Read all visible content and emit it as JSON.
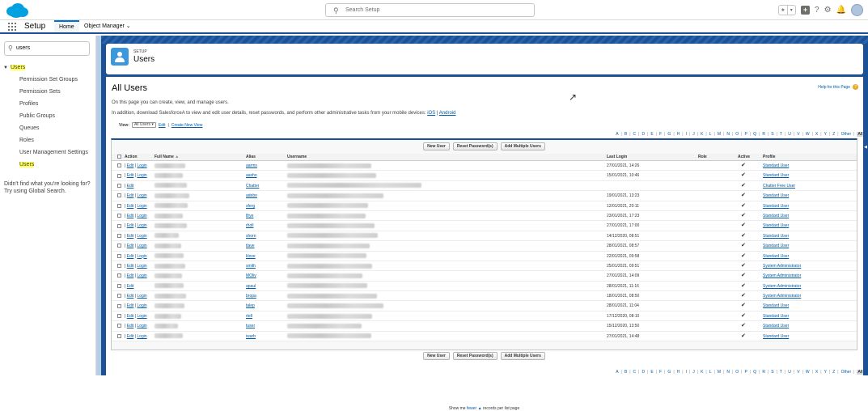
{
  "topbar": {
    "search_placeholder": "Search Setup"
  },
  "nav": {
    "app_name": "Setup",
    "tabs": [
      "Home",
      "Object Manager"
    ]
  },
  "sidebar": {
    "quickfind_value": "users",
    "parent": "Users",
    "items": [
      "Permission Set Groups",
      "Permission Sets",
      "Profiles",
      "Public Groups",
      "Queues",
      "Roles",
      "User Management Settings",
      "Users"
    ],
    "note": "Didn't find what you're looking for? Try using Global Search."
  },
  "header": {
    "setup": "SETUP",
    "title": "Users"
  },
  "page": {
    "title": "All Users",
    "help": "Help for this Page",
    "desc1": "On this page you can create, view, and manage users.",
    "desc2": "In addition, download SalesforceA to view and edit user details, reset passwords, and perform other administrative tasks from your mobile devices:",
    "ios": "iOS",
    "sep": " | ",
    "android": "Android",
    "view_label": "View:",
    "view_value": "All Users",
    "edit": "Edit",
    "create_view": "Create New View",
    "alpha": [
      "A",
      "B",
      "C",
      "D",
      "E",
      "F",
      "G",
      "H",
      "I",
      "J",
      "K",
      "L",
      "M",
      "N",
      "O",
      "P",
      "Q",
      "R",
      "S",
      "T",
      "U",
      "V",
      "W",
      "X",
      "Y",
      "Z",
      "Other",
      "All"
    ],
    "buttons": [
      "New User",
      "Reset Password(s)",
      "Add Multiple Users"
    ],
    "footer_pre": "Show me",
    "footer_link": "fewer",
    "footer_post": "records per list page"
  },
  "table": {
    "headers": {
      "action": "Action",
      "full_name": "Full Name",
      "sort": "▲",
      "alias": "Alias",
      "username": "Username",
      "last_login": "Last Login",
      "role": "Role",
      "active": "Active",
      "profile": "Profile"
    },
    "rows": [
      {
        "login": true,
        "alias": "aarms",
        "last_login": "27/01/2021, 14:26",
        "profile": "Standard User",
        "fn": 38,
        "un": 104
      },
      {
        "login": true,
        "alias": "aasho",
        "last_login": "15/01/2021, 10:46",
        "profile": "Standard User",
        "fn": 35,
        "un": 110
      },
      {
        "login": false,
        "alias": "Chatter",
        "last_login": "",
        "profile": "Chatter Free User",
        "fn": 40,
        "un": 166
      },
      {
        "login": true,
        "alias": "adebo",
        "last_login": "19/01/2021, 13:23",
        "profile": "Standard User",
        "fn": 43,
        "un": 119
      },
      {
        "login": true,
        "alias": "sferg",
        "last_login": "12/01/2021, 20:11",
        "profile": "Standard User",
        "fn": 41,
        "un": 100
      },
      {
        "login": true,
        "alias": "lfrye",
        "last_login": "23/01/2021, 17:23",
        "profile": "Standard User",
        "fn": 35,
        "un": 97
      },
      {
        "login": true,
        "alias": "rholl",
        "last_login": "27/01/2021, 17:00",
        "profile": "Standard User",
        "fn": 40,
        "un": 108
      },
      {
        "login": true,
        "alias": "shorn",
        "last_login": "14/12/2020, 08:51",
        "profile": "Standard User",
        "fn": 30,
        "un": 112
      },
      {
        "login": true,
        "alias": "tlave",
        "last_login": "28/01/2021, 08:57",
        "profile": "Standard User",
        "fn": 33,
        "un": 102
      },
      {
        "login": true,
        "alias": "klove",
        "last_login": "22/01/2021, 09:58",
        "profile": "Standard User",
        "fn": 36,
        "un": 98
      },
      {
        "login": true,
        "alias": "smith",
        "last_login": "25/01/2021, 09:51",
        "profile": "System Administrator",
        "fn": 38,
        "un": 105
      },
      {
        "login": true,
        "alias": "MOliv",
        "last_login": "27/01/2021, 14:09",
        "profile": "System Administrator",
        "fn": 34,
        "un": 93
      },
      {
        "login": false,
        "alias": "apaul",
        "last_login": "28/01/2021, 11:16",
        "profile": "System Administrator",
        "fn": 36,
        "un": 99
      },
      {
        "login": true,
        "alias": "bropa",
        "last_login": "18/01/2021, 08:50",
        "profile": "System Administrator",
        "fn": 39,
        "un": 111
      },
      {
        "login": true,
        "alias": "talep",
        "last_login": "28/01/2021, 11:04",
        "profile": "Standard User",
        "fn": 37,
        "un": 119
      },
      {
        "login": true,
        "alias": "rtell",
        "last_login": "17/12/2020, 08:10",
        "profile": "Standard User",
        "fn": 33,
        "un": 105
      },
      {
        "login": true,
        "alias": "tuser",
        "last_login": "15/12/2020, 13:50",
        "profile": "Standard User",
        "fn": 29,
        "un": 92
      },
      {
        "login": true,
        "alias": "iwarb",
        "last_login": "27/01/2021, 14:48",
        "profile": "Standard User",
        "fn": 35,
        "un": 104
      }
    ],
    "edit_label": "Edit",
    "login_label": "Login",
    "active_mark": "✔"
  },
  "colors": {
    "brand": "#1b5297",
    "link": "#015ba7",
    "highlight": "#ffff5a"
  },
  "icons": [
    "salesforce-cloud-icon",
    "search-icon",
    "favorites-icon",
    "add-icon",
    "help-icon",
    "gear-icon",
    "bell-icon",
    "app-launcher-icon",
    "users-setup-icon",
    "chevron-down-icon"
  ]
}
